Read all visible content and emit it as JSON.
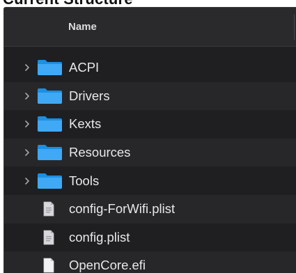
{
  "top_strip_text": "Current Structure",
  "columns": {
    "name_header": "Name"
  },
  "items": [
    {
      "name": "ACPI",
      "kind": "folder",
      "icon": "folder-icon"
    },
    {
      "name": "Drivers",
      "kind": "folder",
      "icon": "folder-icon"
    },
    {
      "name": "Kexts",
      "kind": "folder",
      "icon": "folder-icon"
    },
    {
      "name": "Resources",
      "kind": "folder",
      "icon": "folder-icon"
    },
    {
      "name": "Tools",
      "kind": "folder",
      "icon": "folder-icon"
    },
    {
      "name": "config-ForWifi.plist",
      "kind": "file",
      "icon": "plist-file-icon"
    },
    {
      "name": "config.plist",
      "kind": "file",
      "icon": "plist-file-icon"
    },
    {
      "name": "OpenCore.efi",
      "kind": "file",
      "icon": "efi-file-icon"
    }
  ],
  "colors": {
    "window_bg": "#1f1f21",
    "row_alt_bg": "#272729",
    "header_bg": "#2a2a2c",
    "folder_blue": "#3fa9f5",
    "folder_blue_dark": "#1d8fe0",
    "text": "#e8e8ea"
  }
}
